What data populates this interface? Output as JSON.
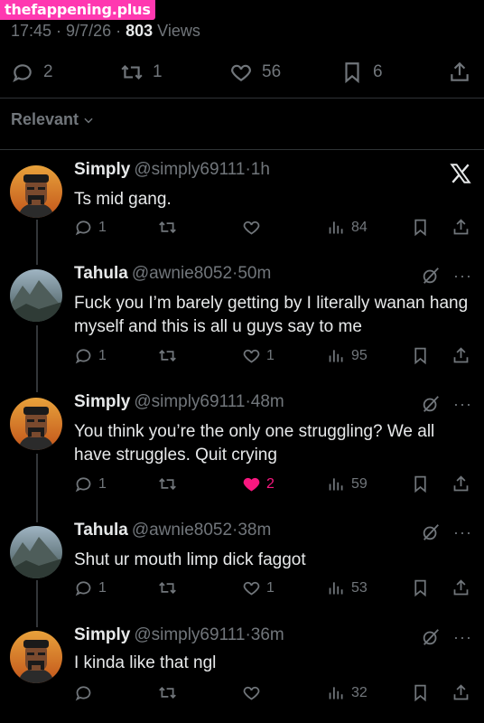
{
  "watermark": "thefappening.plus",
  "post_meta": {
    "time_date": "17:45 · 9/7/26 · ",
    "views_count": "803",
    "views_label": " Views"
  },
  "post_actions": {
    "replies": "2",
    "reposts": "1",
    "likes": "56",
    "bookmarks": "6"
  },
  "filter": {
    "label": "Relevant"
  },
  "colors": {
    "background": "#000000",
    "text": "#e7e9ea",
    "muted": "#71767b",
    "like_active": "#f91880",
    "watermark_bg": "#ff38b0"
  },
  "replies": [
    {
      "name": "Simply",
      "handle": "@simply69111",
      "time": "1h",
      "text": "Ts mid gang.",
      "replies": "1",
      "reposts": "",
      "likes": "",
      "views": "84",
      "liked": false,
      "avatar": "man-avatar",
      "corner_icon": "x-logo-icon"
    },
    {
      "name": "Tahula",
      "handle": "@awnie8052",
      "time": "50m",
      "text": "Fuck you I’m barely getting by I literally wanan hang myself and this is all u guys say to me",
      "replies": "1",
      "reposts": "",
      "likes": "1",
      "views": "95",
      "liked": false,
      "avatar": "mountain-avatar",
      "corner_icon": "grok-icon"
    },
    {
      "name": "Simply",
      "handle": "@simply69111",
      "time": "48m",
      "text": "You think you’re the only one struggling? We all have struggles. Quit crying",
      "replies": "1",
      "reposts": "",
      "likes": "2",
      "views": "59",
      "liked": true,
      "avatar": "man-avatar",
      "corner_icon": "grok-icon"
    },
    {
      "name": "Tahula",
      "handle": "@awnie8052",
      "time": "38m",
      "text": "Shut ur mouth limp dick faggot",
      "replies": "1",
      "reposts": "",
      "likes": "1",
      "views": "53",
      "liked": false,
      "avatar": "mountain-avatar",
      "corner_icon": "grok-icon"
    },
    {
      "name": "Simply",
      "handle": "@simply69111",
      "time": "36m",
      "text": "I kinda like that ngl",
      "replies": "",
      "reposts": "",
      "likes": "",
      "views": "32",
      "liked": false,
      "avatar": "man-avatar",
      "corner_icon": "grok-icon"
    }
  ]
}
